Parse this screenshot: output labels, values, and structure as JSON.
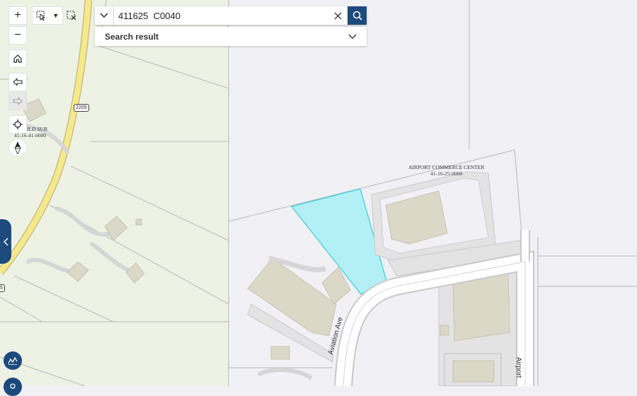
{
  "search": {
    "value": "411625  C0040"
  },
  "results": {
    "label": "Search result"
  },
  "map_labels": {
    "subdivision_name": "ILD SUB",
    "subdivision_id": "41-16-41-0000",
    "commerce_name": "AIRPORT COMMERCE CENTER",
    "commerce_id": "41-16-25-0000",
    "street_aviation": "Aviation Ave",
    "street_airport": "Airport",
    "route_shield": "2205",
    "route_shield_edge": "5"
  },
  "colors": {
    "accent": "#1d4a7c",
    "highlight_fill": "#b3f0f5",
    "highlight_stroke": "#35cfdc",
    "road_yellow": "#f6e88c",
    "building": "#dcd8c8"
  },
  "icons": {
    "zoom_in": "plus-icon",
    "zoom_out": "minus-icon",
    "home": "home-icon",
    "back": "arrow-left-icon",
    "forward": "arrow-right-icon",
    "locate": "crosshair-icon",
    "compass": "compass-icon"
  }
}
